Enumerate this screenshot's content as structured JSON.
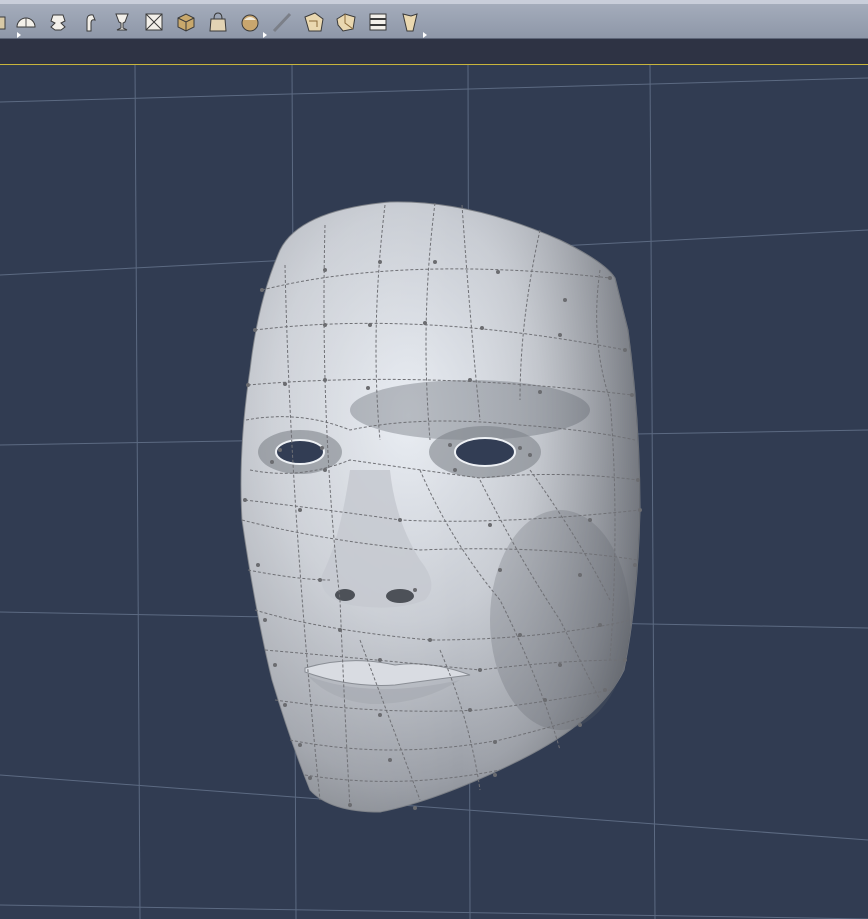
{
  "toolbar": {
    "tools": [
      {
        "name": "dome-icon"
      },
      {
        "name": "lathe-icon"
      },
      {
        "name": "bend-icon"
      },
      {
        "name": "goblet-icon"
      },
      {
        "name": "box-frame-icon"
      },
      {
        "name": "cube-icon"
      },
      {
        "name": "bag-icon"
      },
      {
        "name": "sphere-icon"
      },
      {
        "name": "knife-icon"
      },
      {
        "name": "deform-box-icon"
      },
      {
        "name": "twist-box-icon"
      },
      {
        "name": "cross-section-icon"
      },
      {
        "name": "taper-icon"
      }
    ]
  },
  "viewport": {
    "background_color": "#313c52",
    "grid_color": "#5c6a82",
    "object": "face-mesh",
    "wireframe_color": "#6f7075"
  }
}
